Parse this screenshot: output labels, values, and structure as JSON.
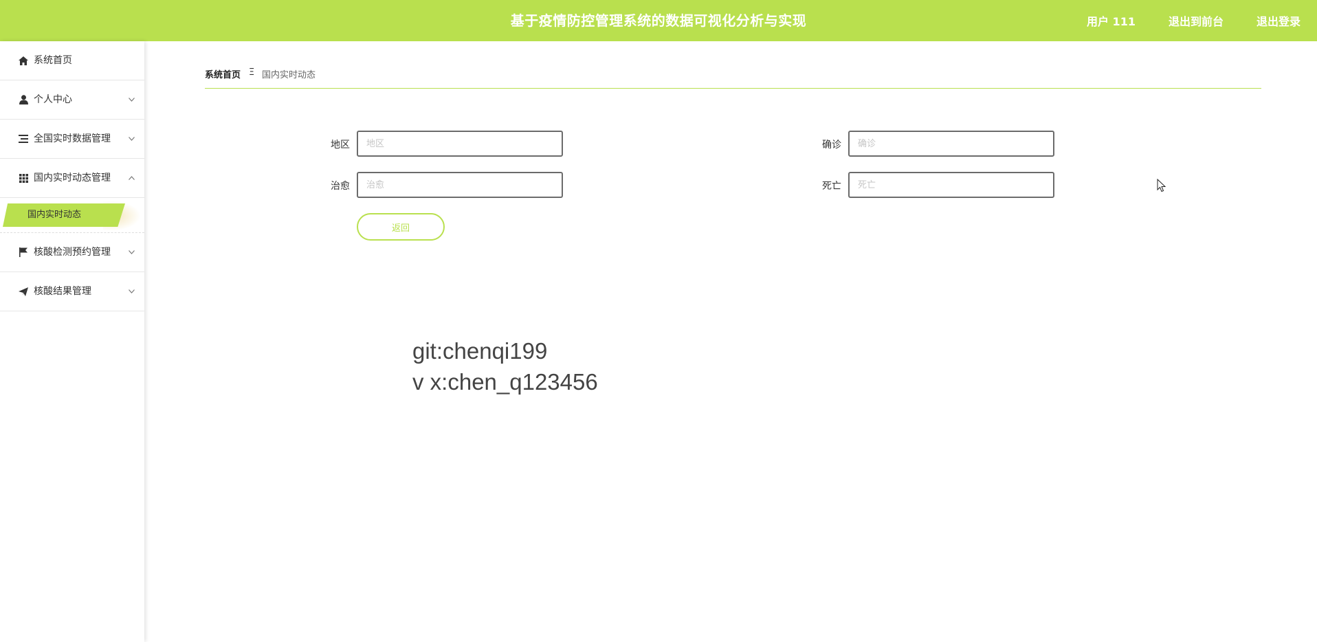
{
  "header": {
    "title": "基于疫情防控管理系统的数据可视化分析与实现",
    "user_label": "用户 111",
    "back_to_admin_label": "退出到前台",
    "logout_label": "退出登录"
  },
  "sidebar": {
    "items": [
      {
        "label": "系统首页",
        "icon": "home-icon",
        "has_arrow": false
      },
      {
        "label": "个人中心",
        "icon": "user-icon",
        "has_arrow": true
      },
      {
        "label": "全国实时数据管理",
        "icon": "list-icon",
        "has_arrow": true
      },
      {
        "label": "国内实时动态管理",
        "icon": "grid-icon",
        "has_arrow": true,
        "expanded": true
      },
      {
        "label": "核酸检测预约管理",
        "icon": "flag-icon",
        "has_arrow": true
      },
      {
        "label": "核酸结果管理",
        "icon": "send-icon",
        "has_arrow": true
      }
    ],
    "active_subitem": "国内实时动态"
  },
  "breadcrumb": {
    "home": "系统首页",
    "separator": "Ξ",
    "current": "国内实时动态"
  },
  "form": {
    "region": {
      "label": "地区",
      "placeholder": "地区",
      "value": ""
    },
    "confirmed": {
      "label": "确诊",
      "placeholder": "确诊",
      "value": ""
    },
    "cured": {
      "label": "治愈",
      "placeholder": "治愈",
      "value": ""
    },
    "deaths": {
      "label": "死亡",
      "placeholder": "死亡",
      "value": ""
    },
    "back_label": "返回"
  },
  "watermark": {
    "line1": "git:chenqi199",
    "line2": "v x:chen_q123456"
  },
  "colors": {
    "accent": "#b9e04e"
  }
}
